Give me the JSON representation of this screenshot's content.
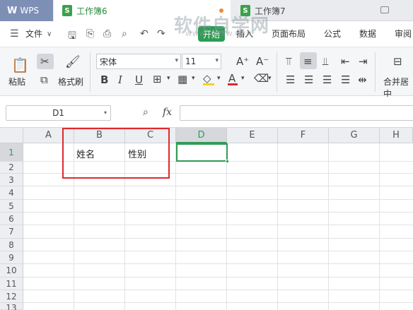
{
  "titlebar": {
    "app_label": "WPS",
    "app_logo": "W",
    "active_tab": "工作簿6",
    "inactive_tab": "工作簿7",
    "doc_icon_glyph": "S"
  },
  "menubar": {
    "file_label": "文件",
    "start_label": "开始",
    "insert_label": "插入",
    "layout_label": "页面布局",
    "formula_label": "公式",
    "data_label": "数据",
    "review_label": "审阅"
  },
  "watermark": {
    "text": "软件自学网",
    "sub": "WWW.RJZXW.COM"
  },
  "ribbon": {
    "paste_label": "粘贴",
    "format_painter_label": "格式刷",
    "font_name": "宋体",
    "font_size": "11",
    "bold": "B",
    "italic": "I",
    "underline": "U",
    "merge_label": "合并居中",
    "colors": {
      "font_red": "#e0292c",
      "fill_yellow": "#f7d21e",
      "accent_green": "#2f9c55"
    }
  },
  "formulabar": {
    "cell_ref": "D1",
    "fx_label": "fx"
  },
  "grid": {
    "columns": [
      "A",
      "B",
      "C",
      "D",
      "E",
      "F",
      "G",
      "H"
    ],
    "rows": [
      "1",
      "2",
      "3",
      "4",
      "5",
      "6",
      "7",
      "8",
      "9",
      "10",
      "11",
      "12",
      "13"
    ],
    "cells": {
      "B1": "姓名",
      "C1": "性别"
    },
    "selected": "D1"
  }
}
